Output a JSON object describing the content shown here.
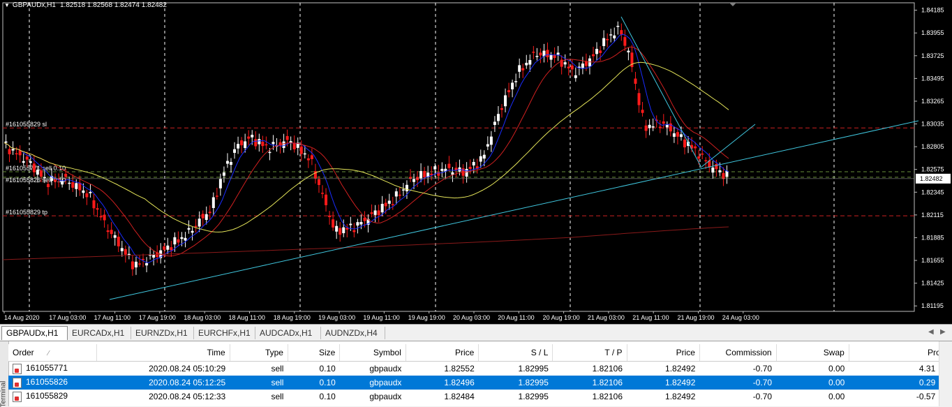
{
  "chart": {
    "symbol_tf": "GBPAUDx,H1",
    "ohlc": "1.82518 1.82568 1.82474 1.82482",
    "current_price": "1.82482",
    "price_ticks": [
      "1.84185",
      "1.83955",
      "1.83725",
      "1.83495",
      "1.83265",
      "1.83035",
      "1.82805",
      "1.82575",
      "1.82345",
      "1.82115",
      "1.81885",
      "1.81655",
      "1.81425",
      "1.81195"
    ],
    "time_ticks": [
      "14 Aug 2020",
      "17 Aug 03:00",
      "17 Aug 11:00",
      "17 Aug 19:00",
      "18 Aug 03:00",
      "18 Aug 11:00",
      "18 Aug 19:00",
      "19 Aug 03:00",
      "19 Aug 11:00",
      "19 Aug 19:00",
      "20 Aug 03:00",
      "20 Aug 11:00",
      "20 Aug 19:00",
      "21 Aug 03:00",
      "21 Aug 11:00",
      "21 Aug 19:00",
      "24 Aug 03:00"
    ],
    "order_labels": {
      "sl": "#161055829 sl",
      "tp": "#161055829 tp",
      "sell1": "#161055771 sell 0.10",
      "sell2": "#161055826 sell 0.10"
    },
    "colors": {
      "bull": "#ffffff",
      "bear": "#ff1a1a",
      "sl_tp_line": "#cc2020",
      "entry_line": "#6a8f3a",
      "trend": "#40c8e0",
      "ma_fast": "#1a2cff",
      "ma_mid": "#d02020",
      "ma_slow": "#e6e65a",
      "ma_long": "#8a1a1a"
    }
  },
  "tabs": {
    "items": [
      "GBPAUDx,H1",
      "EURCADx,H1",
      "EURNZDx,H1",
      "EURCHFx,H1",
      "AUDCADx,H1",
      "AUDNZDx,H4"
    ],
    "active": 0,
    "prev_icon": "chevron-left-icon",
    "next_icon": "chevron-right-icon"
  },
  "terminal": {
    "side_label": "Terminal",
    "columns": [
      "Order",
      "Time",
      "Type",
      "Size",
      "Symbol",
      "Price",
      "S / L",
      "T / P",
      "Price",
      "Commission",
      "Swap",
      "Profit"
    ],
    "rows": [
      [
        "161055771",
        "2020.08.24 05:10:29",
        "sell",
        "0.10",
        "gbpaudx",
        "1.82552",
        "1.82995",
        "1.82106",
        "1.82492",
        "-0.70",
        "0.00",
        "4.31"
      ],
      [
        "161055826",
        "2020.08.24 05:12:25",
        "sell",
        "0.10",
        "gbpaudx",
        "1.82496",
        "1.82995",
        "1.82106",
        "1.82492",
        "-0.70",
        "0.00",
        "0.29"
      ],
      [
        "161055829",
        "2020.08.24 05:12:33",
        "sell",
        "0.10",
        "gbpaudx",
        "1.82484",
        "1.82995",
        "1.82106",
        "1.82492",
        "-0.70",
        "0.00",
        "-0.57"
      ]
    ],
    "selected_row": 1
  }
}
